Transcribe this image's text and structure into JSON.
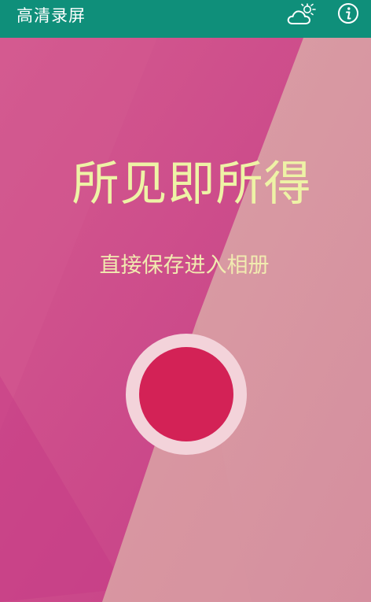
{
  "app_bar": {
    "title": "高清录屏",
    "background": "#0f8f7a",
    "icons": [
      "weather-cloud-sun-icon",
      "info-icon"
    ]
  },
  "hero": {
    "headline": "所见即所得",
    "subline": "直接保存进入相册",
    "text_color": "#eef3a6",
    "colors": {
      "magenta": "#cf4d8c",
      "rose": "#d99aa4",
      "button_ring": "#f3d3da",
      "button_core": "#d32256"
    }
  }
}
